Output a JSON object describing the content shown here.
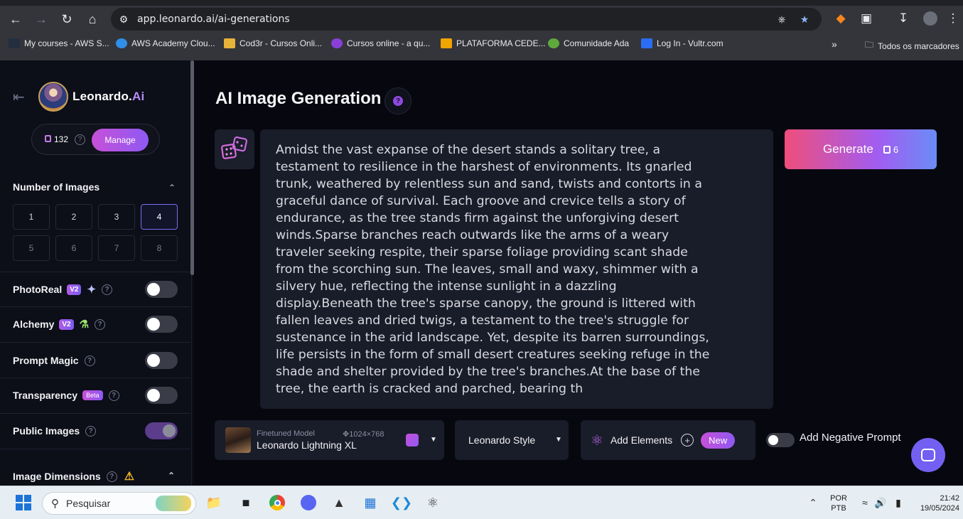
{
  "browser": {
    "url": "app.leonardo.ai/ai-generations",
    "bookmarks": [
      {
        "label": "My courses - AWS S...",
        "color": "#232f3e"
      },
      {
        "label": "AWS Academy Clou...",
        "color": "#2f8fe8"
      },
      {
        "label": "Cod3r - Cursos Onli...",
        "color": "#e8b33a"
      },
      {
        "label": "Cursos online - a qu...",
        "color": "#8b3fd9"
      },
      {
        "label": "PLATAFORMA CEDE...",
        "color": "#f0a500"
      },
      {
        "label": "Comunidade Ada",
        "color": "#5fa83b"
      },
      {
        "label": "Log In - Vultr.com",
        "color": "#2a6df4"
      }
    ],
    "all_bookmarks": "Todos os marcadores"
  },
  "sidebar": {
    "brand_main": "Leonardo.",
    "brand_accent": "Ai",
    "tokens": "132",
    "manage_label": "Manage",
    "number_of_images_title": "Number of Images",
    "image_counts": [
      "1",
      "2",
      "3",
      "4",
      "5",
      "6",
      "7",
      "8"
    ],
    "selected_count": "4",
    "options": {
      "photoreal": {
        "label": "PhotoReal",
        "badge": "V2",
        "enabled": false
      },
      "alchemy": {
        "label": "Alchemy",
        "badge": "V2",
        "enabled": false
      },
      "prompt_magic": {
        "label": "Prompt Magic",
        "enabled": false
      },
      "transparency": {
        "label": "Transparency",
        "badge": "Beta",
        "enabled": false
      },
      "public_images": {
        "label": "Public Images",
        "enabled": true
      }
    },
    "image_dimensions_title": "Image Dimensions"
  },
  "main": {
    "title": "AI Image Generation",
    "prompt": "Amidst the vast expanse of the desert stands a solitary tree, a\ntestament to resilience in the harshest of environments. Its gnarled\ntrunk, weathered by relentless sun and sand, twists and contorts in a\ngraceful dance of survival. Each groove and crevice tells a story of\nendurance, as the tree stands firm against the unforgiving desert\nwinds.Sparse branches reach outwards like the arms of a weary\ntraveler seeking respite, their sparse foliage providing scant shade\nfrom the scorching sun. The leaves, small and waxy, shimmer with a\nsilvery hue, reflecting the intense sunlight in a dazzling\ndisplay.Beneath the tree's sparse canopy, the ground is littered with\nfallen leaves and dried twigs, a testament to the tree's struggle for\nsustenance in the arid landscape. Yet, despite its barren surroundings,\nlife persists in the form of small desert creatures seeking refuge in the\nshade and shelter provided by the tree's branches.At the base of the\ntree, the earth is cracked and parched, bearing th",
    "generate_label": "Generate",
    "generate_cost": "6",
    "model": {
      "type_label": "Finetuned Model",
      "resolution": "1024×768",
      "name": "Leonardo Lightning XL"
    },
    "style_label": "Leonardo Style",
    "add_elements_label": "Add Elements",
    "new_badge": "New",
    "negative_prompt_label": "Add Negative Prompt",
    "negative_prompt_enabled": false
  },
  "taskbar": {
    "search_placeholder": "Pesquisar",
    "lang_line1": "POR",
    "lang_line2": "PTB",
    "time": "21:42",
    "date": "19/05/2024"
  }
}
